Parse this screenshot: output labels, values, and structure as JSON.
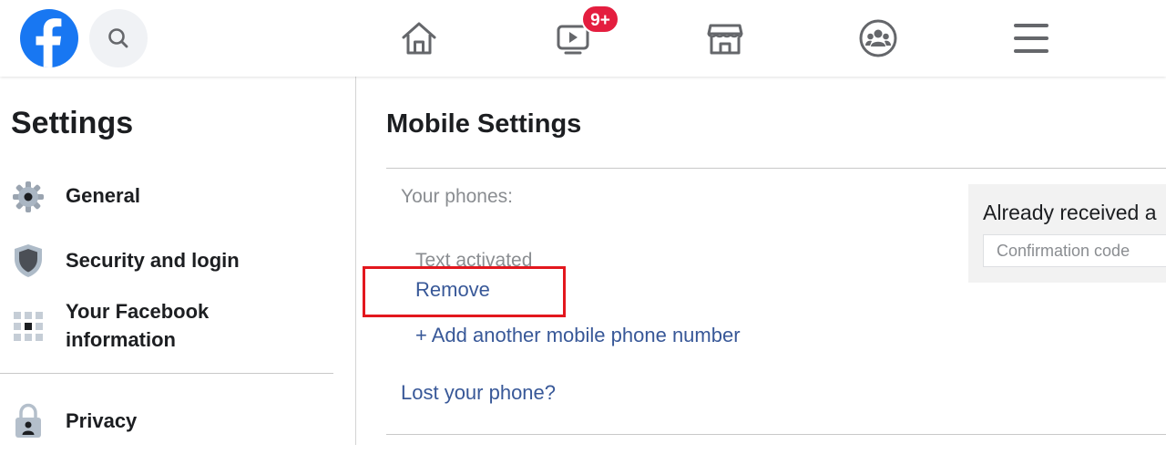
{
  "topbar": {
    "logo_icon": "facebook-logo-icon",
    "search_icon": "search-icon",
    "tabs": [
      {
        "name": "home",
        "icon": "home-icon"
      },
      {
        "name": "watch",
        "icon": "video-icon",
        "badge": "9+"
      },
      {
        "name": "marketplace",
        "icon": "store-icon"
      },
      {
        "name": "groups",
        "icon": "groups-icon"
      },
      {
        "name": "menu",
        "icon": "hamburger-menu-icon"
      }
    ],
    "badge_color": "#e41e3f"
  },
  "sidebar": {
    "title": "Settings",
    "items": [
      {
        "label": "General",
        "icon": "gear-icon"
      },
      {
        "label": "Security and login",
        "icon": "shield-icon"
      },
      {
        "label": "Your Facebook information",
        "icon": "grid-icon"
      },
      {
        "label": "Privacy",
        "icon": "lock-icon"
      }
    ]
  },
  "main": {
    "title": "Mobile Settings",
    "phones_label": "Your phones:",
    "status": "Text activated",
    "remove_link": "Remove",
    "add_link": "+ Add another mobile phone number",
    "lost_link": "Lost your phone?",
    "confirm": {
      "text": "Already received a",
      "placeholder": "Confirmation code"
    }
  },
  "colors": {
    "brand": "#1877f2",
    "link": "#385898",
    "highlight": "#e3171e"
  }
}
